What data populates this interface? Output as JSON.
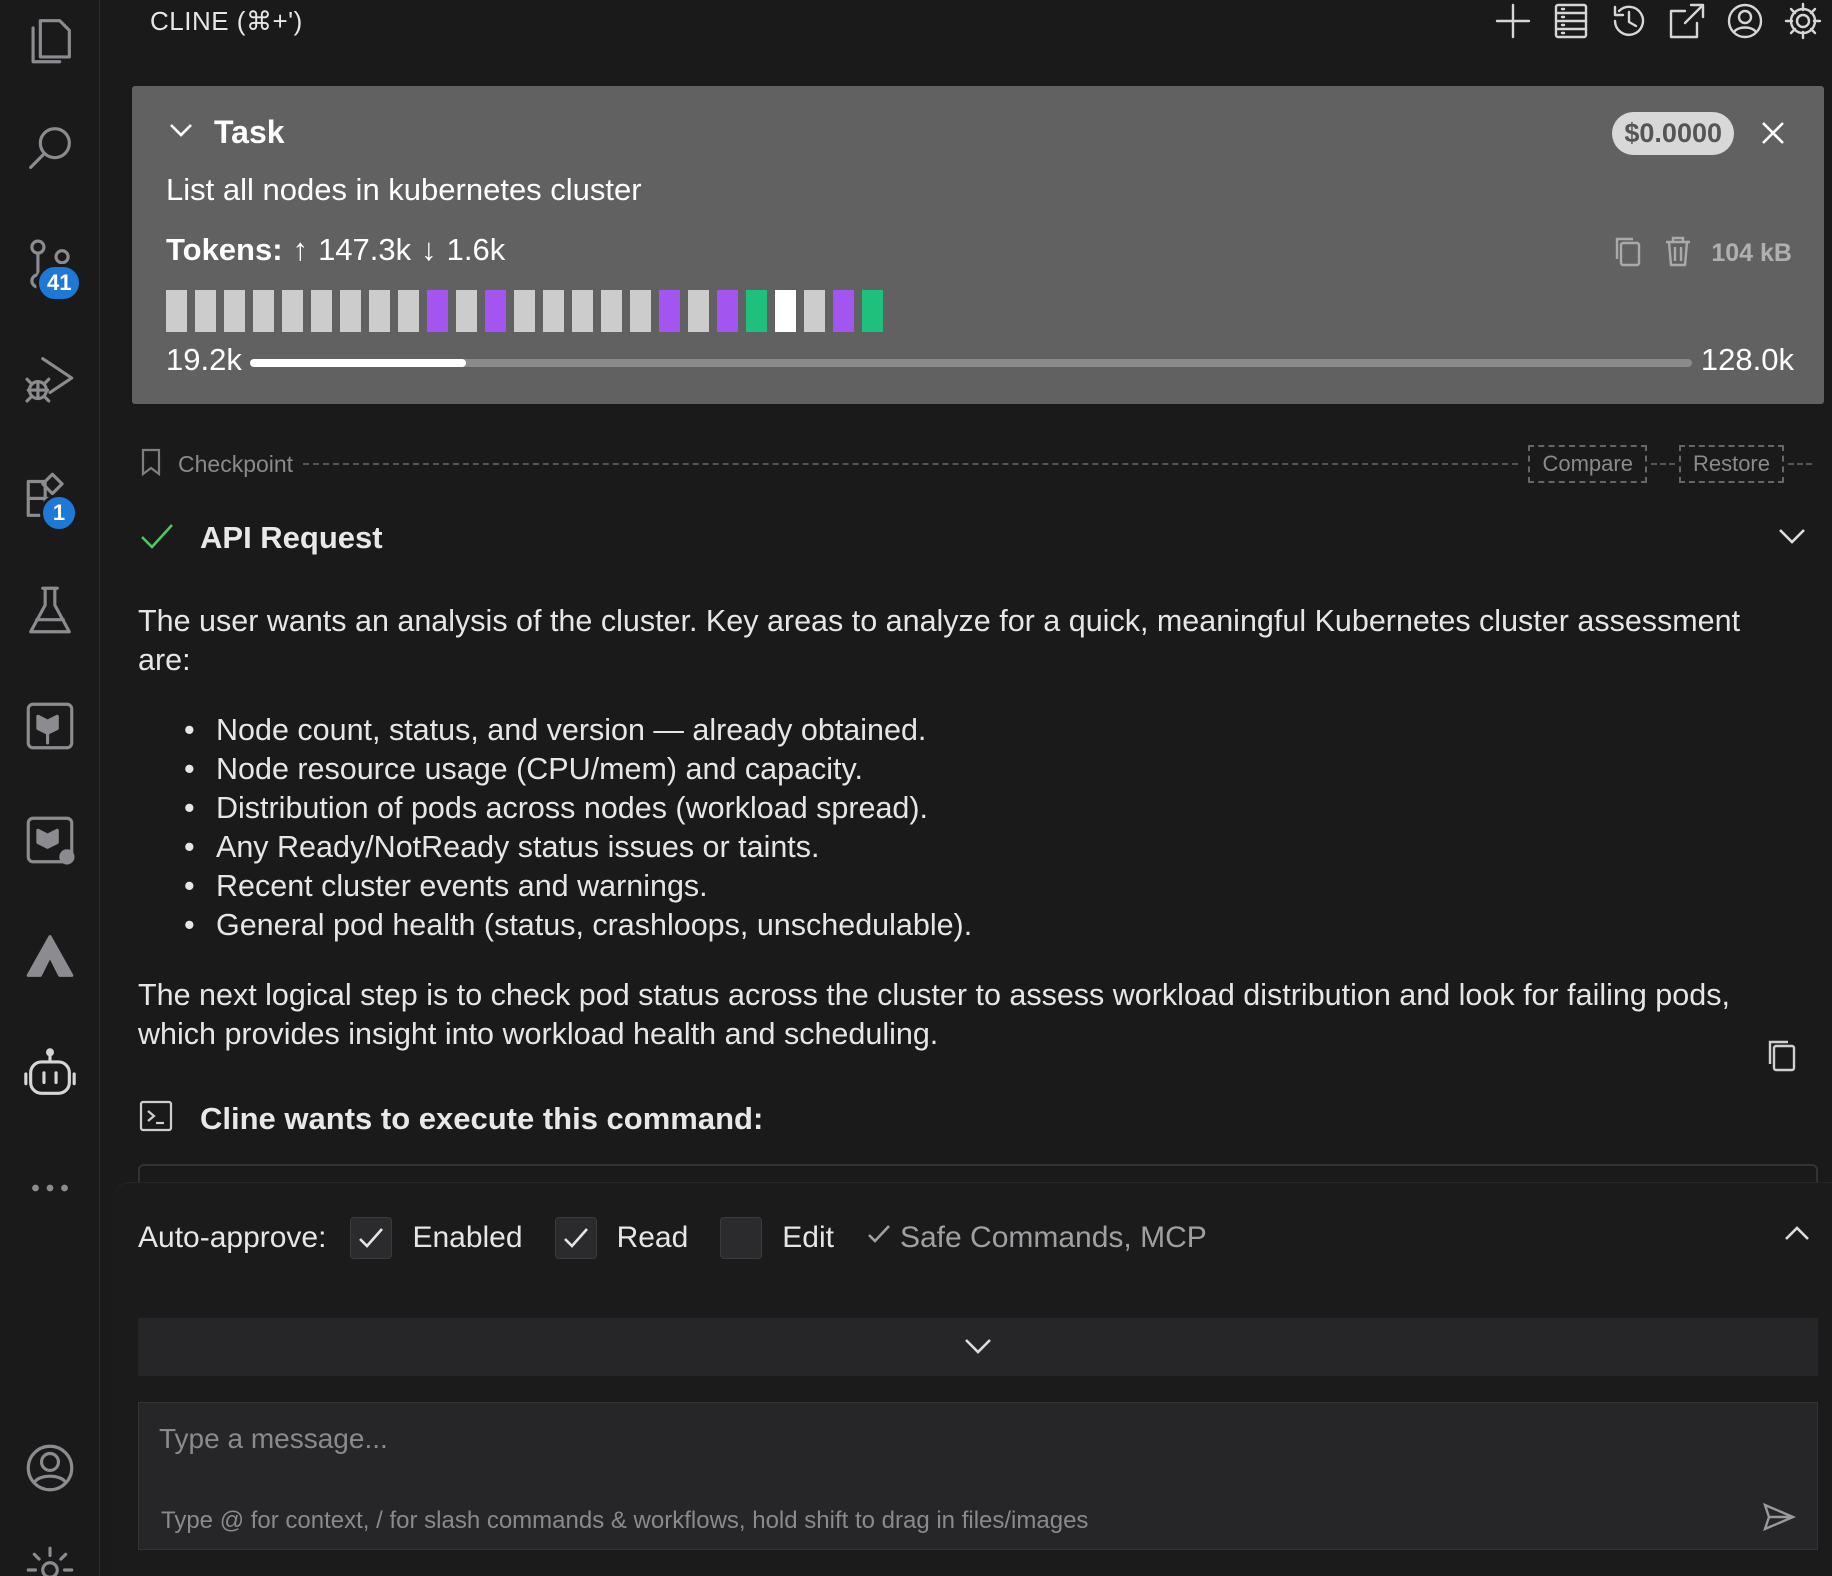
{
  "activity_bar": {
    "items": [
      {
        "name": "explorer-icon"
      },
      {
        "name": "search-icon"
      },
      {
        "name": "source-control-icon",
        "badge": "41"
      },
      {
        "name": "run-debug-icon"
      },
      {
        "name": "extensions-icon",
        "badge": "1"
      },
      {
        "name": "testing-icon"
      },
      {
        "name": "terraform-icon"
      },
      {
        "name": "terraform-cloud-icon"
      },
      {
        "name": "aws-icon"
      },
      {
        "name": "cline-bot-icon"
      },
      {
        "name": "more-icon"
      }
    ],
    "bottom": [
      {
        "name": "account-icon"
      },
      {
        "name": "manage-gear-icon"
      }
    ]
  },
  "header": {
    "title": "CLINE (⌘+')",
    "icons": [
      "plus-icon",
      "mcp-servers-icon",
      "history-icon",
      "open-external-icon",
      "account-icon",
      "settings-icon"
    ]
  },
  "task": {
    "label": "Task",
    "cost": "$0.0000",
    "description": "List all nodes in kubernetes cluster",
    "tokens_label": "Tokens:",
    "tokens_in": "147.3k",
    "tokens_out": "1.6k",
    "size": "104 kB",
    "context_min": "19.2k",
    "context_max": "128.0k",
    "context_used_fraction": 0.15,
    "blocks": [
      "#cccccc",
      "#cccccc",
      "#cccccc",
      "#cccccc",
      "#cccccc",
      "#cccccc",
      "#cccccc",
      "#cccccc",
      "#cccccc",
      "#a355f0",
      "#cccccc",
      "#a355f0",
      "#cccccc",
      "#cccccc",
      "#cccccc",
      "#cccccc",
      "#cccccc",
      "#a355f0",
      "#cccccc",
      "#a355f0",
      "#1fbf7c",
      "#ffffff",
      "#cccccc",
      "#a355f0",
      "#1fbf7c"
    ]
  },
  "checkpoint": {
    "label": "Checkpoint",
    "compare": "Compare",
    "restore": "Restore"
  },
  "api_request": {
    "title": "API Request"
  },
  "message": {
    "intro": "The user wants an analysis of the cluster. Key areas to analyze for a quick, meaningful Kubernetes cluster assessment are:",
    "bullets": [
      "Node count, status, and version — already obtained.",
      "Node resource usage (CPU/mem) and capacity.",
      "Distribution of pods across nodes (workload spread).",
      "Any Ready/NotReady status issues or taints.",
      "Recent cluster events and warnings.",
      "General pod health (status, crashloops, unschedulable)."
    ],
    "conclusion": "The next logical step is to check pod status across the cluster to assess workload distribution and look for failing pods, which provides insight into workload health and scheduling."
  },
  "command": {
    "title": "Cline wants to execute this command:"
  },
  "auto_approve": {
    "label": "Auto-approve:",
    "options": [
      {
        "label": "Enabled",
        "checked": true
      },
      {
        "label": "Read",
        "checked": true
      },
      {
        "label": "Edit",
        "checked": false
      }
    ],
    "summary": "Safe Commands, MCP"
  },
  "input": {
    "placeholder": "Type a message...",
    "hint": "Type @ for context, / for slash commands & workflows, hold shift to drag in files/images"
  }
}
